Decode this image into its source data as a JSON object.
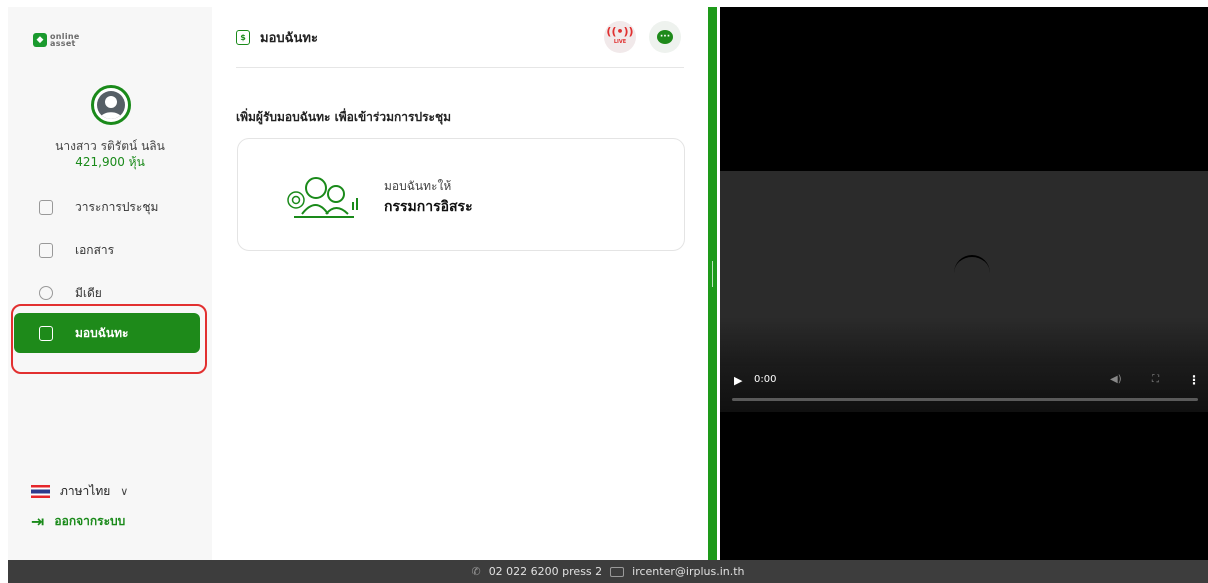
{
  "brand": {
    "logo_line1": "online",
    "logo_line2": "asset",
    "accent": "#1e8a1a"
  },
  "user": {
    "name": "นางสาว รติรัตน์ นลิน",
    "shares": "421,900 หุ้น"
  },
  "sidebar": {
    "items": [
      {
        "label": "วาระการประชุม",
        "icon": "agenda-icon"
      },
      {
        "label": "เอกสาร",
        "icon": "folder-icon"
      },
      {
        "label": "มีเดีย",
        "icon": "play-circle-icon"
      },
      {
        "label": "มอบฉันทะ",
        "icon": "proxy-document-icon",
        "active": true
      }
    ],
    "language": "ภาษาไทย",
    "logout": "ออกจากระบบ"
  },
  "main": {
    "title": "มอบฉันทะ",
    "live_label": "LIVE",
    "subtitle": "เพิ่มผู้รับมอบฉันทะ เพื่อเข้าร่วมการประชุม",
    "card": {
      "small_label": "มอบฉันทะให้",
      "big_label": "กรรมการอิสระ"
    }
  },
  "video": {
    "time": "0:00"
  },
  "footer": {
    "phone": "02 022 6200 press 2",
    "email": "ircenter@irplus.in.th"
  }
}
